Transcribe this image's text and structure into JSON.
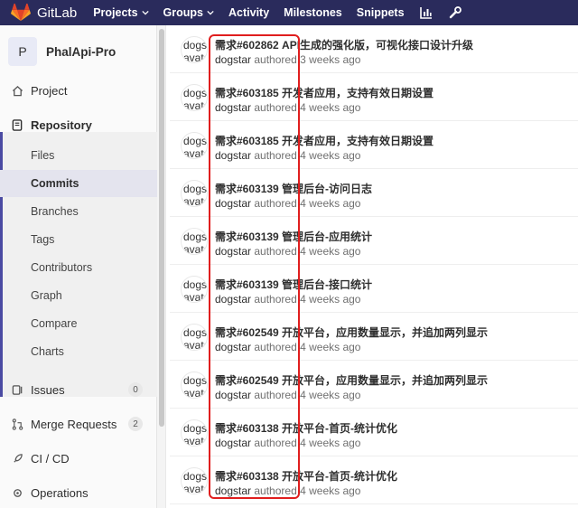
{
  "navbar": {
    "brand": "GitLab",
    "items": [
      {
        "label": "Projects",
        "dropdown": true
      },
      {
        "label": "Groups",
        "dropdown": true
      },
      {
        "label": "Activity",
        "dropdown": false
      },
      {
        "label": "Milestones",
        "dropdown": false
      },
      {
        "label": "Snippets",
        "dropdown": false
      }
    ],
    "icons": [
      "chart-icon",
      "wrench-icon"
    ],
    "bg_color": "#2a2b5c"
  },
  "sidebar": {
    "project_initial": "P",
    "project_name": "PhalApi-Pro",
    "project_label": "Project",
    "repository_label": "Repository",
    "repo_sub": [
      "Files",
      "Commits",
      "Branches",
      "Tags",
      "Contributors",
      "Graph",
      "Compare",
      "Charts"
    ],
    "issues_label": "Issues",
    "issues_count": "0",
    "mr_label": "Merge Requests",
    "mr_count": "2",
    "cicd_label": "CI / CD",
    "operations_label": "Operations",
    "accent_color": "#4b4ba3"
  },
  "commits": [
    {
      "avatar": "dogs avata",
      "title": "需求#602862 API生成的强化版，可视化接口设计升级",
      "author": "dogstar",
      "action": "authored",
      "time": "3 weeks ago"
    },
    {
      "avatar": "dogs avata",
      "title": "需求#603185 开发者应用，支持有效日期设置",
      "author": "dogstar",
      "action": "authored",
      "time": "4 weeks ago"
    },
    {
      "avatar": "dogs avata",
      "title": "需求#603185 开发者应用，支持有效日期设置",
      "author": "dogstar",
      "action": "authored",
      "time": "4 weeks ago"
    },
    {
      "avatar": "dogs avata",
      "title": "需求#603139 管理后台-访问日志",
      "author": "dogstar",
      "action": "authored",
      "time": "4 weeks ago"
    },
    {
      "avatar": "dogs avata",
      "title": "需求#603139 管理后台-应用统计",
      "author": "dogstar",
      "action": "authored",
      "time": "4 weeks ago"
    },
    {
      "avatar": "dogs avata",
      "title": "需求#603139 管理后台-接口统计",
      "author": "dogstar",
      "action": "authored",
      "time": "4 weeks ago"
    },
    {
      "avatar": "dogs avata",
      "title": "需求#602549 开放平台，应用数量显示，并追加两列显示",
      "author": "dogstar",
      "action": "authored",
      "time": "4 weeks ago"
    },
    {
      "avatar": "dogs avata",
      "title": "需求#602549 开放平台，应用数量显示，并追加两列显示",
      "author": "dogstar",
      "action": "authored",
      "time": "4 weeks ago"
    },
    {
      "avatar": "dogs avata",
      "title": "需求#603138 开放平台-首页-统计优化",
      "author": "dogstar",
      "action": "authored",
      "time": "4 weeks ago"
    },
    {
      "avatar": "dogs avata",
      "title": "需求#603138 开放平台-首页-统计优化",
      "author": "dogstar",
      "action": "authored",
      "time": "4 weeks ago"
    }
  ],
  "highlight_color": "#e01e1e"
}
